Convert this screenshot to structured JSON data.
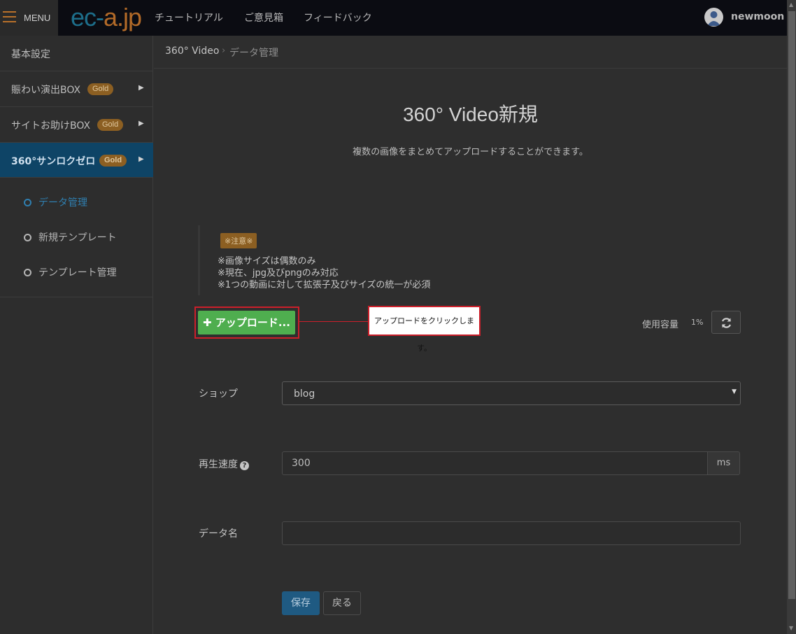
{
  "header": {
    "menu_label": "MENU",
    "logo_part1": "ec-",
    "logo_part2": "a.jp",
    "nav": [
      "チュートリアル",
      "ご意見箱",
      "フィードバック"
    ],
    "username": "newmoon"
  },
  "sidebar": {
    "items": [
      {
        "label": "基本設定"
      },
      {
        "label": "賑わい演出BOX",
        "badge": "Gold"
      },
      {
        "label": "サイトお助けBOX",
        "badge": "Gold"
      },
      {
        "label": "360°サンロクゼロ",
        "badge": "Gold"
      }
    ],
    "submenu": [
      "データ管理",
      "新規テンプレート",
      "テンプレート管理"
    ]
  },
  "breadcrumb": {
    "root": "360° Video",
    "separator": "›",
    "current": "データ管理"
  },
  "page": {
    "title": "360° Video新規",
    "description": "複数の画像をまとめてアップロードすることができます。"
  },
  "notice": {
    "badge": "※注意※",
    "lines": [
      "※画像サイズは偶数のみ",
      "※現在、jpg及びpngのみ対応",
      "※1つの動画に対して拡張子及びサイズの統一が必須"
    ]
  },
  "upload": {
    "button_label": "✚ アップロード...",
    "callout": "アップロードをクリックします。"
  },
  "capacity": {
    "label": "使用容量",
    "value": "1%"
  },
  "form": {
    "shop_label": "ショップ",
    "shop_value": "blog",
    "speed_label": "再生速度",
    "speed_value": "300",
    "speed_unit": "ms",
    "name_label": "データ名",
    "name_value": ""
  },
  "actions": {
    "save": "保存",
    "back": "戻る"
  },
  "colors": {
    "accent_green": "#4fae4f",
    "highlight_red": "#cc1f2a",
    "gold_badge": "#8c5f22",
    "active_blue": "#0e4466"
  }
}
